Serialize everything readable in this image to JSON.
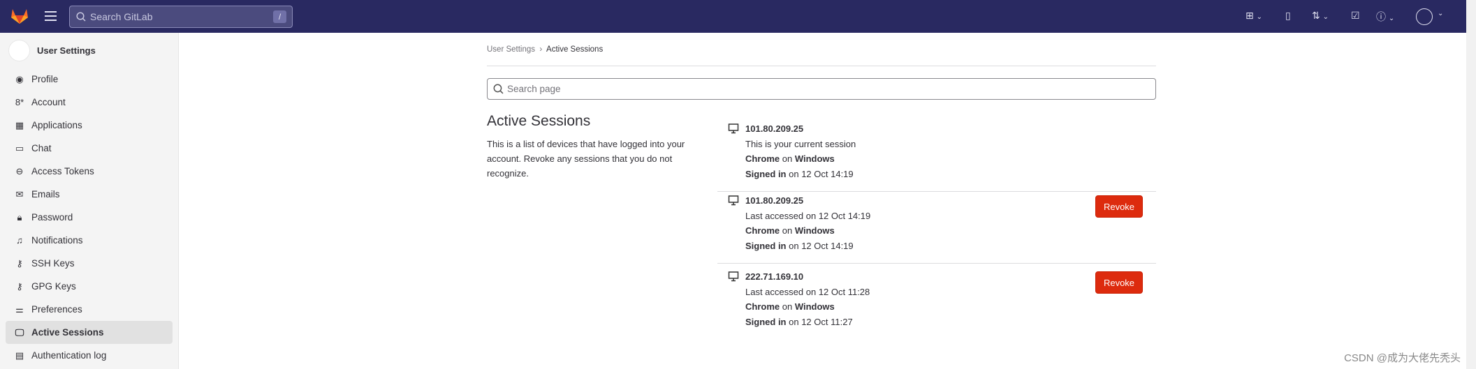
{
  "header": {
    "search_placeholder": "Search GitLab",
    "search_shortcut": "/",
    "icons": [
      "gitlab-logo",
      "menu-icon",
      "plus-square-icon",
      "issues-icon",
      "merge-request-icon",
      "todo-icon",
      "help-icon",
      "avatar"
    ]
  },
  "sidebar": {
    "title": "User Settings",
    "items": [
      {
        "label": "Profile",
        "icon": "profile-icon"
      },
      {
        "label": "Account",
        "icon": "account-icon"
      },
      {
        "label": "Applications",
        "icon": "applications-icon"
      },
      {
        "label": "Chat",
        "icon": "chat-icon"
      },
      {
        "label": "Access Tokens",
        "icon": "token-icon"
      },
      {
        "label": "Emails",
        "icon": "mail-icon"
      },
      {
        "label": "Password",
        "icon": "lock-icon"
      },
      {
        "label": "Notifications",
        "icon": "bell-icon"
      },
      {
        "label": "SSH Keys",
        "icon": "key-icon"
      },
      {
        "label": "GPG Keys",
        "icon": "key-icon"
      },
      {
        "label": "Preferences",
        "icon": "preferences-icon"
      },
      {
        "label": "Active Sessions",
        "icon": "monitor-icon",
        "active": true
      },
      {
        "label": "Authentication log",
        "icon": "log-icon"
      }
    ]
  },
  "breadcrumb": {
    "parent": "User Settings",
    "current": "Active Sessions"
  },
  "page_search": {
    "placeholder": "Search page"
  },
  "section": {
    "title": "Active Sessions",
    "description": "This is a list of devices that have logged into your account. Revoke any sessions that you do not recognize."
  },
  "sessions": [
    {
      "ip": "101.80.209.25",
      "status": "This is your current session",
      "browser": "Chrome",
      "on": "on",
      "os": "Windows",
      "signed_label": "Signed in",
      "signed_at": "on 12 Oct 14:19",
      "revoke": null
    },
    {
      "ip": "101.80.209.25",
      "status": "Last accessed on 12 Oct 14:19",
      "browser": "Chrome",
      "on": "on",
      "os": "Windows",
      "signed_label": "Signed in",
      "signed_at": "on 12 Oct 14:19",
      "revoke": "Revoke"
    },
    {
      "ip": "222.71.169.10",
      "status": "Last accessed on 12 Oct 11:28",
      "browser": "Chrome",
      "on": "on",
      "os": "Windows",
      "signed_label": "Signed in",
      "signed_at": "on 12 Oct 11:27",
      "revoke": "Revoke"
    }
  ],
  "watermark": "CSDN @成为大佬先秃头",
  "colors": {
    "topbar": "#292961",
    "danger": "#dd2b0e",
    "sidebar": "#f4f4f4"
  }
}
